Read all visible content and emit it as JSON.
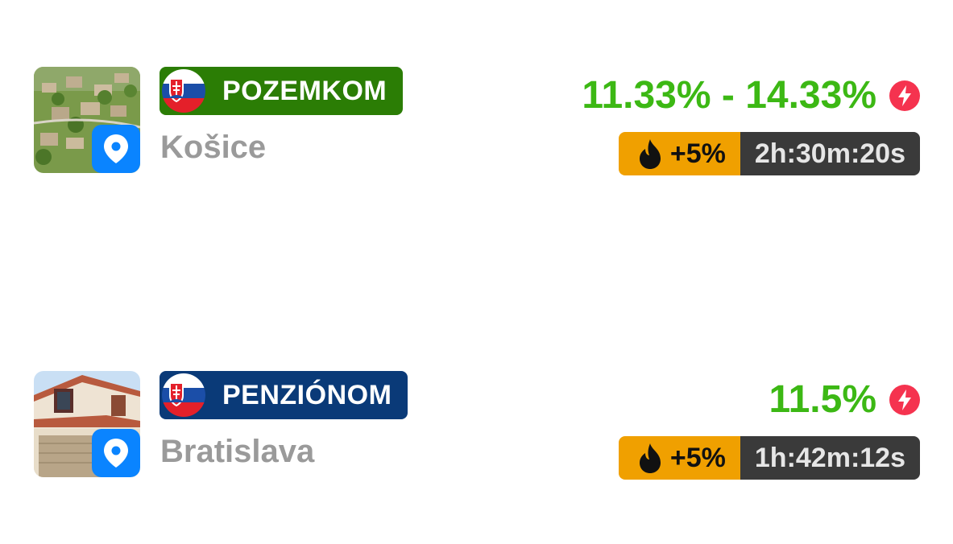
{
  "listings": [
    {
      "category": "POZEMKOM",
      "city": "Košice",
      "rate": "11.33% - 14.33%",
      "boost": "+5%",
      "countdown": "2h:30m:20s",
      "badge_color": "#2b7d05",
      "icons": [
        "location-pin-icon",
        "flag-slovakia-icon",
        "lightning-icon",
        "flame-icon"
      ]
    },
    {
      "category": "PENZIÓNOM",
      "city": "Bratislava",
      "rate": "11.5%",
      "boost": "+5%",
      "countdown": "1h:42m:12s",
      "badge_color": "#0a3a78",
      "icons": [
        "location-pin-icon",
        "flag-slovakia-icon",
        "lightning-icon",
        "flame-icon"
      ]
    }
  ],
  "colors": {
    "rate_green": "#3cb814",
    "boost_orange": "#f0a000",
    "timer_dark": "#3a3a3a",
    "pin_blue": "#0a84ff",
    "bolt_red": "#f5334f"
  }
}
